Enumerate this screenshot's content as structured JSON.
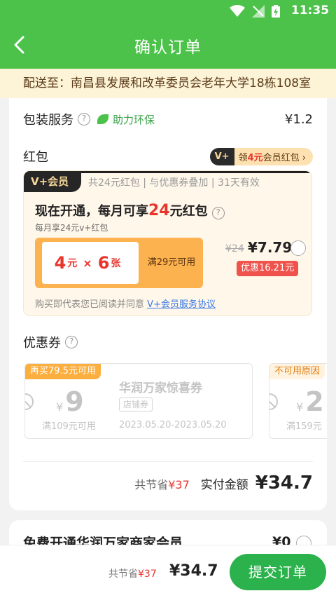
{
  "status_bar": {
    "time": "11:35"
  },
  "header": {
    "title": "确认订单"
  },
  "address": {
    "text": "配送至：南昌县发展和改革委员会老年大学18栋108室"
  },
  "packaging": {
    "label": "包装服务",
    "eco_text": "助力环保",
    "price": "¥1.2"
  },
  "red_packet": {
    "label": "红包",
    "pill_tag": "V+",
    "pill_text_prefix": "领",
    "pill_text_amount": "4元",
    "pill_text_suffix": "会员红包 ›"
  },
  "vip_offer": {
    "badge": "V+会员",
    "subtitle": "共24元红包 | 与优惠券叠加 | 31天有效",
    "headline_prefix": "现在开通，每月可享",
    "headline_amount": "24",
    "headline_suffix": "元红包",
    "note": "每月享24元v+红包",
    "ticket_amount": "4",
    "ticket_unit": "元",
    "ticket_times": "×",
    "ticket_count": "6",
    "ticket_count_unit": "张",
    "ticket_condition": "满29元可用",
    "old_price": "¥24",
    "new_price": "¥7.79",
    "save_tag": "优惠16.21元",
    "agree_prefix": "购买即代表您已阅读并同意",
    "agree_link": "V+会员服务协议"
  },
  "coupons": {
    "label": "优惠券",
    "items": [
      {
        "tag": "再买79.5元可用",
        "currency": "¥",
        "amount": "9",
        "condition": "满109元可用",
        "name": "华润万家惊喜券",
        "shop_tag": "店铺券",
        "date_range": "2023.05.20-2023.05.20"
      },
      {
        "tag": "不可用原因",
        "currency": "¥",
        "amount": "2",
        "condition": "满159元"
      }
    ]
  },
  "summary": {
    "save_prefix": "共节省",
    "save_amount": "¥37",
    "pay_label": "实付金额",
    "pay_amount": "¥34.7"
  },
  "member_card": {
    "title": "免费开通华润万家商家会员",
    "price": "¥0"
  },
  "bottom_bar": {
    "save_prefix": "共节省",
    "save_amount": "¥37",
    "total": "¥34.7",
    "submit_label": "提交订单"
  },
  "colors": {
    "brand_green": "#4cc24a",
    "accent_red": "#e8352c",
    "submit_green": "#2bb24c"
  }
}
